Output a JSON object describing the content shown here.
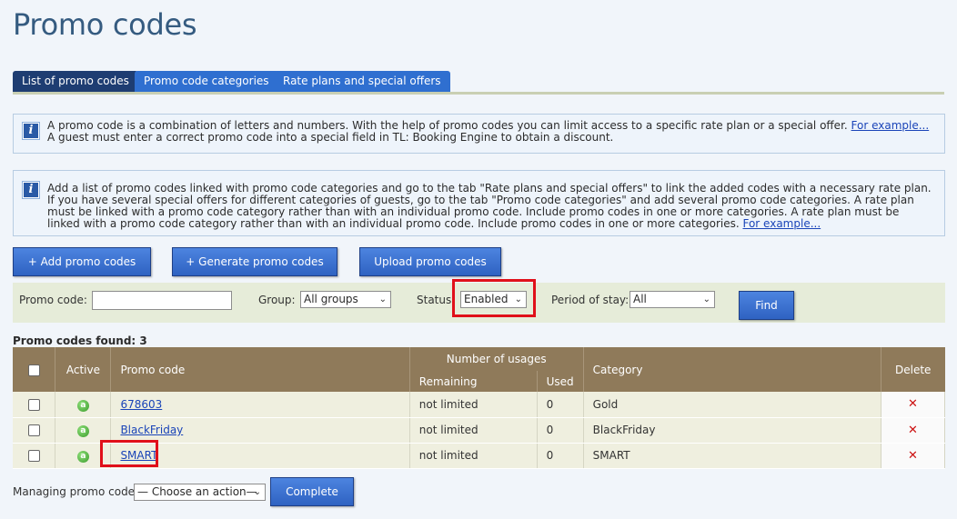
{
  "page": {
    "title": "Promo codes"
  },
  "tabs": [
    {
      "label": "List of promo codes",
      "active": true
    },
    {
      "label": "Promo code categories",
      "active": false
    },
    {
      "label": "Rate plans and special offers",
      "active": false
    }
  ],
  "info_boxes": [
    {
      "text": "A promo code is a combination of letters and numbers. With the help of promo codes you can limit access to a specific rate plan or a special offer. ",
      "link": "For example...",
      "text_after": " A guest must enter a correct promo code into a special field in TL: Booking Engine to obtain a discount."
    },
    {
      "text": "Add a list of promo codes linked with promo code categories and go to the tab \"Rate plans and special offers\" to link the added codes with a necessary rate plan. If you have several special offers for different categories of guests, go to the tab \"Promo code categories\" and add several promo code categories. A rate plan must be linked with a promo code category rather than with an individual promo code. Include promo codes in one or more categories. A rate plan must be linked with a promo code category rather than with an individual promo code. Include promo codes in one or more categories. ",
      "link": "For example..."
    }
  ],
  "actions": {
    "add": "+ Add promo codes",
    "generate": "+ Generate promo codes",
    "upload": "Upload promo codes"
  },
  "filters": {
    "promo_code_label": "Promo code:",
    "promo_code_value": "",
    "group_label": "Group:",
    "group_value": "All groups",
    "status_label": "Status:",
    "status_value": "Enabled",
    "period_label": "Period of stay:",
    "period_value": "All",
    "find_label": "Find"
  },
  "results": {
    "found_label": "Promo codes found: 3",
    "headers": {
      "active": "Active",
      "promo_code": "Promo code",
      "usages": "Number of usages",
      "remaining": "Remaining",
      "used": "Used",
      "category": "Category",
      "delete": "Delete"
    },
    "rows": [
      {
        "code": "678603",
        "remaining": "not limited",
        "used": "0",
        "category": "Gold"
      },
      {
        "code": "BlackFriday",
        "remaining": "not limited",
        "used": "0",
        "category": "BlackFriday"
      },
      {
        "code": "SMART",
        "remaining": "not limited",
        "used": "0",
        "category": "SMART"
      }
    ]
  },
  "manage": {
    "label": "Managing promo codes",
    "select_value": "— Choose an action—",
    "complete_label": "Complete"
  },
  "icons": {
    "info": "info-icon",
    "active": "active-status-icon",
    "delete": "delete-icon",
    "dropdown": "chevron-down-icon"
  },
  "colors": {
    "accent": "#2f62c2",
    "table_header": "#8f7a5a",
    "highlight": "#e0101a"
  }
}
